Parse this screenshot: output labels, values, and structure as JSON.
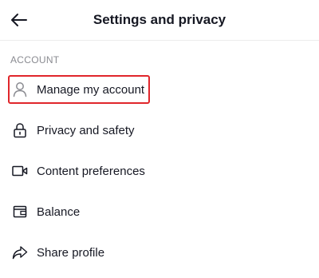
{
  "header": {
    "title": "Settings and privacy",
    "back_icon": "arrow-left-icon"
  },
  "account_section": {
    "label": "ACCOUNT",
    "items": [
      {
        "label": "Manage my account",
        "icon": "person-icon",
        "highlighted": true
      },
      {
        "label": "Privacy and safety",
        "icon": "lock-icon"
      },
      {
        "label": "Content preferences",
        "icon": "video-camera-icon"
      },
      {
        "label": "Balance",
        "icon": "wallet-icon"
      },
      {
        "label": "Share profile",
        "icon": "share-arrow-icon"
      }
    ]
  },
  "colors": {
    "highlight_border": "#e0262b",
    "text": "#161823",
    "muted": "#8a8b91"
  }
}
